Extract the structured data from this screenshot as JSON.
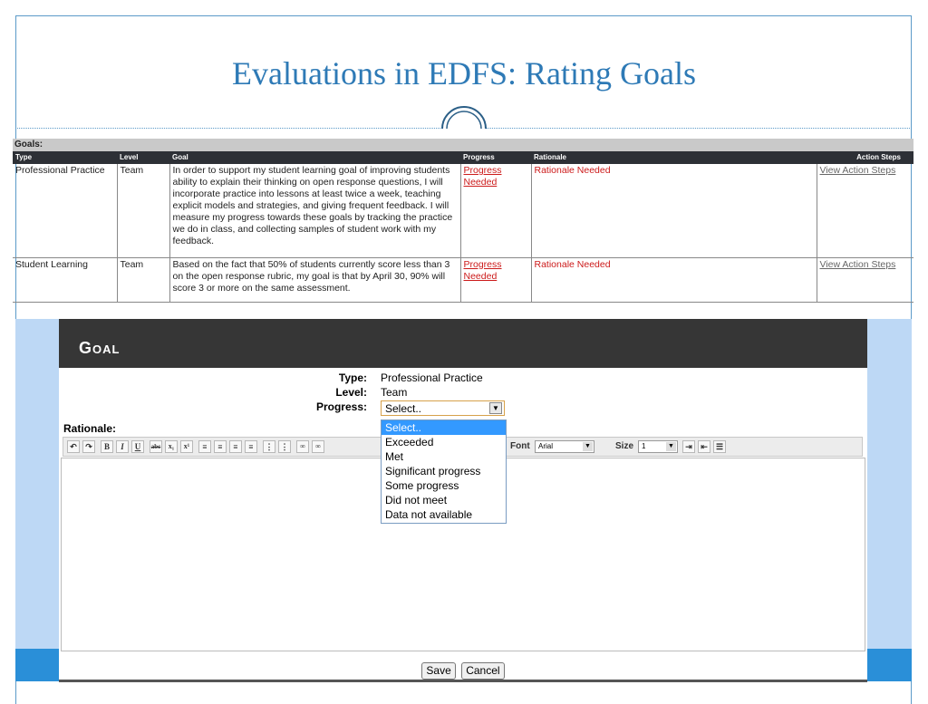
{
  "slide": {
    "title": "Evaluations in EDFS: Rating Goals"
  },
  "goals": {
    "section_label": "Goals:",
    "columns": [
      "Type",
      "Level",
      "Goal",
      "Progress",
      "Rationale",
      "Action Steps"
    ],
    "rows": [
      {
        "type": "Professional Practice",
        "level": "Team",
        "goal": "In order to support my student learning goal of improving students ability to explain their thinking on open response questions, I will incorporate practice into lessons at least twice a week, teaching explicit models and strategies, and giving frequent feedback. I will measure my progress towards these goals by tracking the practice we do in class, and collecting samples of student work with my feedback.",
        "progress": "Progress Needed",
        "rationale": "Rationale Needed",
        "action": "View Action Steps"
      },
      {
        "type": "Student Learning",
        "level": "Team",
        "goal": "Based on the fact that 50% of students currently score less than 3 on the open response rubric, my goal is that by April 30, 90% will score 3 or more on the same assessment.",
        "progress": "Progress Needed",
        "rationale": "Rationale Needed",
        "action": "View Action Steps"
      }
    ]
  },
  "goal_form": {
    "header": "Goal",
    "type_label": "Type:",
    "type_value": "Professional Practice",
    "level_label": "Level:",
    "level_value": "Team",
    "progress_label": "Progress:",
    "progress_selected": "Select..",
    "progress_options": [
      "Select..",
      "Exceeded",
      "Met",
      "Significant progress",
      "Some progress",
      "Did not meet",
      "Data not available"
    ],
    "rationale_label": "Rationale:",
    "toolbar": {
      "font_label": "Font",
      "font_value": "Arial",
      "size_label": "Size",
      "size_value": "1"
    },
    "save_label": "Save",
    "cancel_label": "Cancel"
  }
}
